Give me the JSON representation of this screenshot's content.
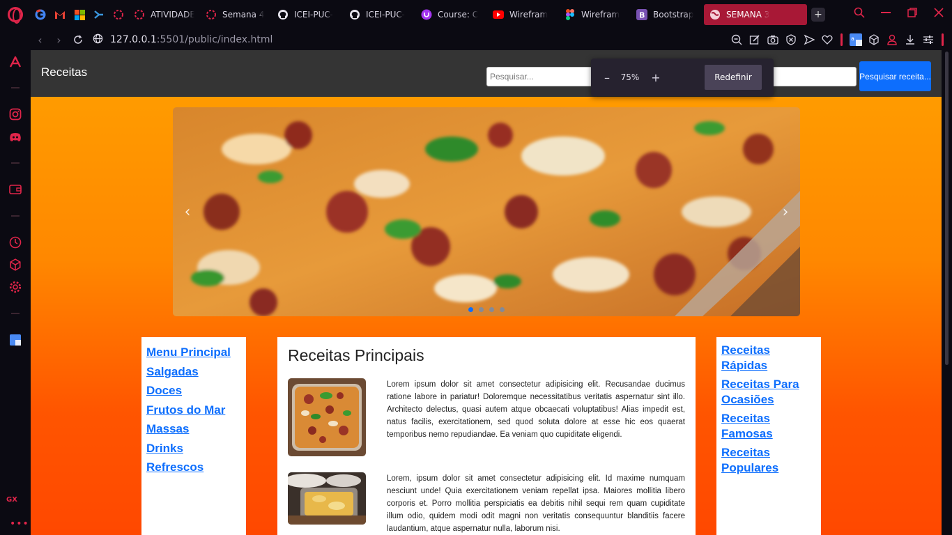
{
  "browser": {
    "tabs": [
      {
        "label": "ATIVIDADE",
        "icon": "opera-ring-icon"
      },
      {
        "label": "Semana 4",
        "icon": "opera-ring-icon"
      },
      {
        "label": "ICEI-PUC-",
        "icon": "github-icon"
      },
      {
        "label": "ICEI-PUC-",
        "icon": "github-icon"
      },
      {
        "label": "Course: C",
        "icon": "udemy-icon"
      },
      {
        "label": "Wirefram",
        "icon": "youtube-icon"
      },
      {
        "label": "Wirefram",
        "icon": "figma-icon"
      },
      {
        "label": "Bootstrap",
        "icon": "bootstrap-icon"
      }
    ],
    "active_tab": {
      "label": "SEMANA 3",
      "icon": "globe-icon"
    },
    "new_tab_label": "+",
    "url_host": "127.0.0.1",
    "url_path": ":5501/public/index.html",
    "accent_color": "#e0254a",
    "active_tab_color": "#a81836"
  },
  "site": {
    "title": "Receitas",
    "search_placeholder": "Pesquisar...",
    "search_button": "Pesquisar receita...",
    "header_color": "#343434",
    "button_color": "#0d6efd"
  },
  "zoom_popup": {
    "minus": "–",
    "value": "75%",
    "plus": "+",
    "reset_label": "Redefinir"
  },
  "carousel": {
    "prev": "‹",
    "next": "›",
    "slide_count": 4,
    "active_index": 0
  },
  "left_menu": [
    "Menu Principal",
    "Salgadas",
    "Doces",
    "Frutos do Mar",
    "Massas",
    "Drinks",
    "Refrescos"
  ],
  "main": {
    "title": "Receitas Principais",
    "recipes": [
      {
        "text": "Lorem ipsum dolor sit amet consectetur adipisicing elit. Recusandae ducimus ratione labore in pariatur! Doloremque necessitatibus veritatis aspernatur sint illo. Architecto delectus, quasi autem atque obcaecati voluptatibus! Alias impedit est, natus facilis, exercitationem, sed quod soluta dolore at esse hic eos quaerat temporibus nemo repudiandae. Ea veniam quo cupiditate eligendi."
      },
      {
        "text": "Lorem, ipsum dolor sit amet consectetur adipisicing elit. Id maxime numquam nesciunt unde! Quia exercitationem veniam repellat ipsa. Maiores mollitia libero corporis et. Porro mollitia perspiciatis ea debitis nihil sequi rem quam cupiditate illum odio, quidem modi odit magni non veritatis consequuntur blanditiis facere laudantium, atque aspernatur nulla, laborum nisi."
      }
    ]
  },
  "right_menu": [
    "Receitas Rápidas",
    "Receitas Para Ocasiões",
    "Receitas Famosas",
    "Receitas Populares"
  ]
}
